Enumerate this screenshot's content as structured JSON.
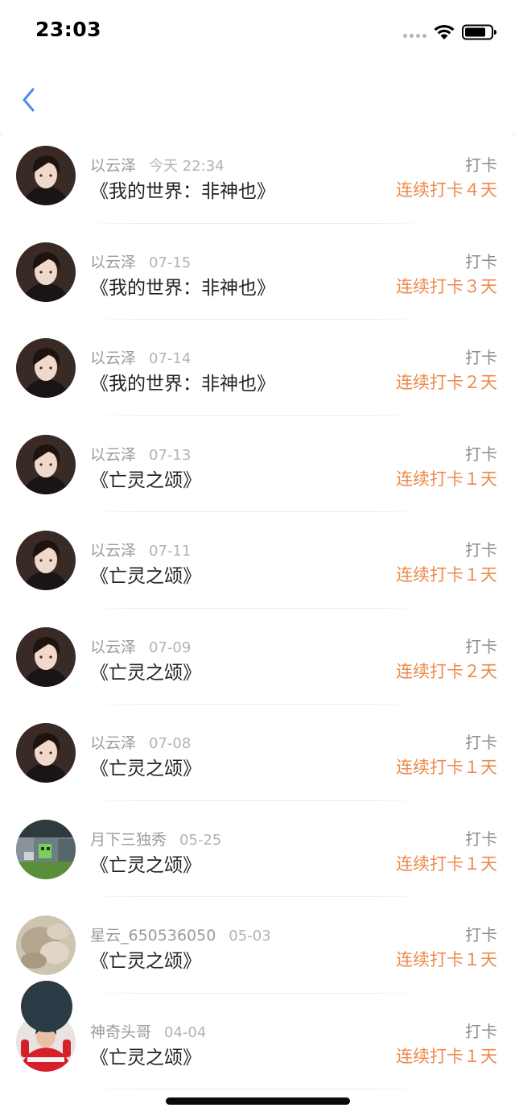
{
  "status_bar": {
    "time": "23:03",
    "icons": [
      "signal-dots-icon",
      "wifi-icon",
      "battery-icon"
    ]
  },
  "nav": {
    "back_icon": "chevron-left-icon",
    "accent_color": "#4a90e2"
  },
  "colors": {
    "streak": "#ec8a4d",
    "name": "#9b9b9b",
    "title": "#222222"
  },
  "entries": [
    {
      "user": "以云泽",
      "date": "今天 22:34",
      "title": "《我的世界：非神也》",
      "type": "打卡",
      "streak": "连续打卡４天",
      "avatar": "anime-boy-avatar"
    },
    {
      "user": "以云泽",
      "date": "07-15",
      "title": "《我的世界：非神也》",
      "type": "打卡",
      "streak": "连续打卡３天",
      "avatar": "anime-boy-avatar"
    },
    {
      "user": "以云泽",
      "date": "07-14",
      "title": "《我的世界：非神也》",
      "type": "打卡",
      "streak": "连续打卡２天",
      "avatar": "anime-boy-avatar"
    },
    {
      "user": "以云泽",
      "date": "07-13",
      "title": "《亡灵之颂》",
      "type": "打卡",
      "streak": "连续打卡１天",
      "avatar": "anime-boy-avatar"
    },
    {
      "user": "以云泽",
      "date": "07-11",
      "title": "《亡灵之颂》",
      "type": "打卡",
      "streak": "连续打卡１天",
      "avatar": "anime-boy-avatar"
    },
    {
      "user": "以云泽",
      "date": "07-09",
      "title": "《亡灵之颂》",
      "type": "打卡",
      "streak": "连续打卡２天",
      "avatar": "anime-boy-avatar"
    },
    {
      "user": "以云泽",
      "date": "07-08",
      "title": "《亡灵之颂》",
      "type": "打卡",
      "streak": "连续打卡１天",
      "avatar": "anime-boy-avatar"
    },
    {
      "user": "月下三独秀",
      "date": "05-25",
      "title": "《亡灵之颂》",
      "type": "打卡",
      "streak": "连续打卡１天",
      "avatar": "game-scene-avatar"
    },
    {
      "user": "星云_650536050",
      "date": "05-03",
      "title": "《亡灵之颂》",
      "type": "打卡",
      "streak": "连续打卡１天",
      "avatar": "blurry-photo-avatar"
    },
    {
      "user": "神奇头哥",
      "date": "04-04",
      "title": "《亡灵之颂》",
      "type": "打卡",
      "streak": "连续打卡１天",
      "avatar": "racing-driver-avatar"
    }
  ]
}
